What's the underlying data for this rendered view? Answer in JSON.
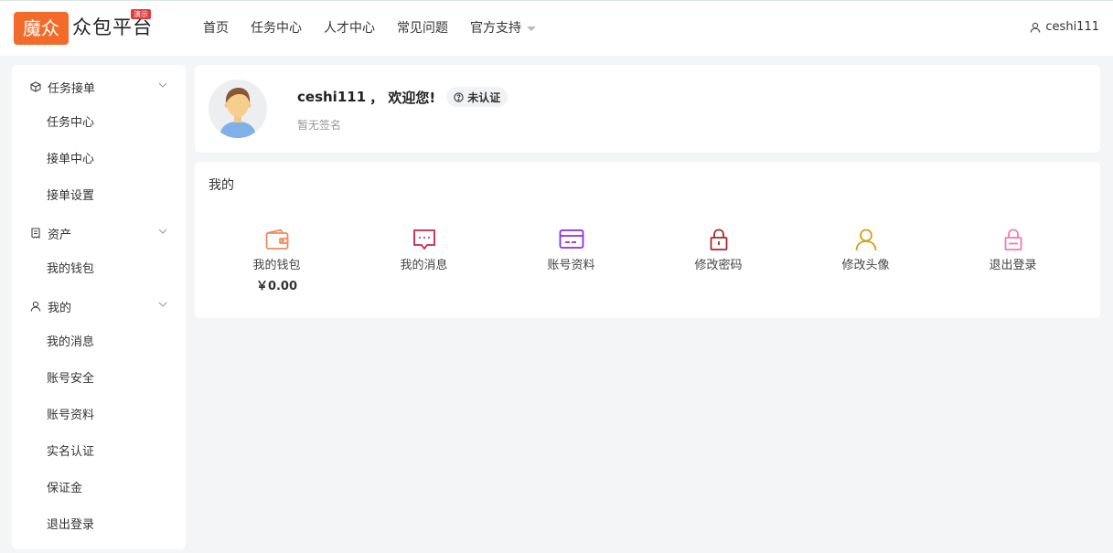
{
  "header": {
    "logo_badge": "魔众",
    "logo_text": "众包平台",
    "demo_tag": "演示",
    "nav": [
      "首页",
      "任务中心",
      "人才中心",
      "常见问题",
      "官方支持"
    ],
    "username": "ceshi111"
  },
  "sidebar": {
    "groups": [
      {
        "label": "任务接单",
        "icon": "cube-icon",
        "items": [
          "任务中心",
          "接单中心",
          "接单设置"
        ]
      },
      {
        "label": "资产",
        "icon": "receipt-icon",
        "items": [
          "我的钱包"
        ]
      },
      {
        "label": "我的",
        "icon": "user-icon",
        "items": [
          "我的消息",
          "账号安全",
          "账号资料",
          "实名认证",
          "保证金",
          "退出登录"
        ]
      }
    ]
  },
  "profile": {
    "name": "ceshi111",
    "greeting": "， 欢迎您!",
    "cert_status": "未认证",
    "signature": "暂无签名"
  },
  "mine": {
    "title": "我的",
    "items": [
      {
        "label": "我的钱包",
        "value": "￥0.00",
        "icon": "wallet-icon",
        "color": "#f08a5d"
      },
      {
        "label": "我的消息",
        "icon": "message-icon",
        "color": "#c7254e"
      },
      {
        "label": "账号资料",
        "icon": "card-icon",
        "color": "#8e2de2"
      },
      {
        "label": "修改密码",
        "icon": "lock-icon",
        "color": "#a52a2a"
      },
      {
        "label": "修改头像",
        "icon": "user-icon",
        "color": "#d4a017"
      },
      {
        "label": "退出登录",
        "icon": "lock-icon",
        "color": "#f178b6"
      }
    ]
  }
}
